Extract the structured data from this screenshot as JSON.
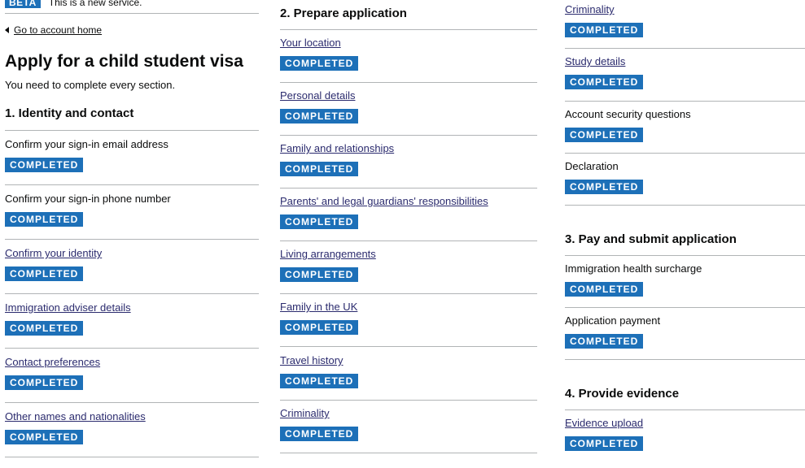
{
  "banner": {
    "tag": "BETA",
    "text": "This is a new service."
  },
  "back_link": {
    "label": "Go to account home"
  },
  "page": {
    "title": "Apply for a child student visa",
    "intro": "You need to complete every section."
  },
  "status_label": "COMPLETED",
  "sections": [
    {
      "heading": "1. Identity and contact",
      "tasks": [
        {
          "name": "Confirm your sign-in email address",
          "is_link": false,
          "status": "COMPLETED"
        },
        {
          "name": "Confirm your sign-in phone number",
          "is_link": false,
          "status": "COMPLETED"
        },
        {
          "name": "Confirm your identity",
          "is_link": true,
          "status": "COMPLETED"
        },
        {
          "name": "Immigration adviser details",
          "is_link": true,
          "status": "COMPLETED"
        },
        {
          "name": "Contact preferences",
          "is_link": true,
          "status": "COMPLETED"
        },
        {
          "name": "Other names and nationalities",
          "is_link": true,
          "status": "COMPLETED"
        }
      ]
    },
    {
      "heading": "2. Prepare application",
      "tasks": [
        {
          "name": "Your location",
          "is_link": true,
          "status": "COMPLETED"
        },
        {
          "name": "Personal details",
          "is_link": true,
          "status": "COMPLETED"
        },
        {
          "name": "Family and relationships",
          "is_link": true,
          "status": "COMPLETED"
        },
        {
          "name": "Parents' and legal guardians' responsibilities",
          "is_link": true,
          "status": "COMPLETED"
        },
        {
          "name": "Living arrangements",
          "is_link": true,
          "status": "COMPLETED"
        },
        {
          "name": "Family in the UK",
          "is_link": true,
          "status": "COMPLETED"
        },
        {
          "name": "Travel history",
          "is_link": true,
          "status": "COMPLETED"
        },
        {
          "name": "Criminality",
          "is_link": true,
          "status": "COMPLETED"
        },
        {
          "name": "Criminality",
          "is_link": true,
          "status": "COMPLETED"
        },
        {
          "name": "Study details",
          "is_link": true,
          "status": "COMPLETED"
        },
        {
          "name": "Account security questions",
          "is_link": false,
          "status": "COMPLETED"
        },
        {
          "name": "Declaration",
          "is_link": false,
          "status": "COMPLETED"
        }
      ]
    },
    {
      "heading": "3. Pay and submit application",
      "tasks": [
        {
          "name": "Immigration health surcharge",
          "is_link": false,
          "status": "COMPLETED"
        },
        {
          "name": "Application payment",
          "is_link": false,
          "status": "COMPLETED"
        }
      ]
    },
    {
      "heading": "4. Provide evidence",
      "tasks": [
        {
          "name": "Evidence upload",
          "is_link": true,
          "status": "COMPLETED"
        }
      ]
    }
  ],
  "colors": {
    "tag_blue": "#1d70b8",
    "link": "#2b2b6e",
    "text": "#0b0c0c",
    "rule": "#b1b4b6"
  }
}
